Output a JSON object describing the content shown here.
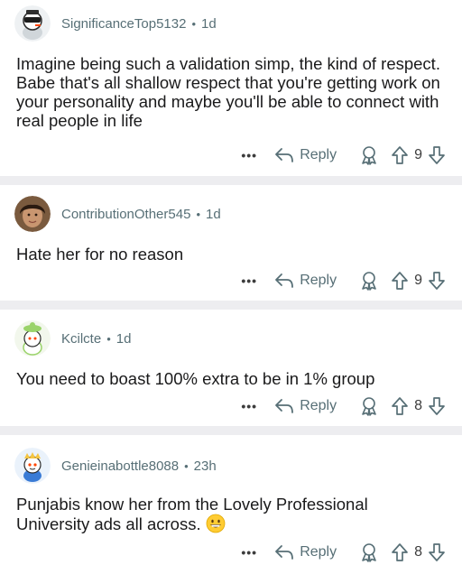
{
  "comments": [
    {
      "username": "SignificanceTop5132",
      "separator": "•",
      "time": "1d",
      "text": "Imagine being such a validation simp, the kind of respect. Babe that's all shallow respect that you're getting work on your personality and maybe you'll be able to connect with real people in life",
      "reply_label": "Reply",
      "more_label": "•••",
      "votes": "9"
    },
    {
      "username": "ContributionOther545",
      "separator": "•",
      "time": "1d",
      "text": "Hate her for no reason",
      "reply_label": "Reply",
      "more_label": "•••",
      "votes": "9"
    },
    {
      "username": "Kcilcte",
      "separator": "•",
      "time": "1d",
      "text": "You need to boast 100% extra to be in 1% group",
      "reply_label": "Reply",
      "more_label": "•••",
      "votes": "8"
    },
    {
      "username": "Genieinabottle8088",
      "separator": "•",
      "time": "23h",
      "text": "Punjabis know her from the Lovely Professional University ads all across.",
      "reply_label": "Reply",
      "more_label": "•••",
      "votes": "8"
    }
  ],
  "icons": {
    "reply": "reply-arrow-icon",
    "award": "award-icon",
    "upvote": "upvote-arrow-icon",
    "downvote": "downvote-arrow-icon",
    "emoji": "grinning-face-emoji"
  },
  "colors": {
    "meta_text": "#576f76",
    "body_text": "#1a1a1b",
    "separator_band": "#ededf0"
  }
}
